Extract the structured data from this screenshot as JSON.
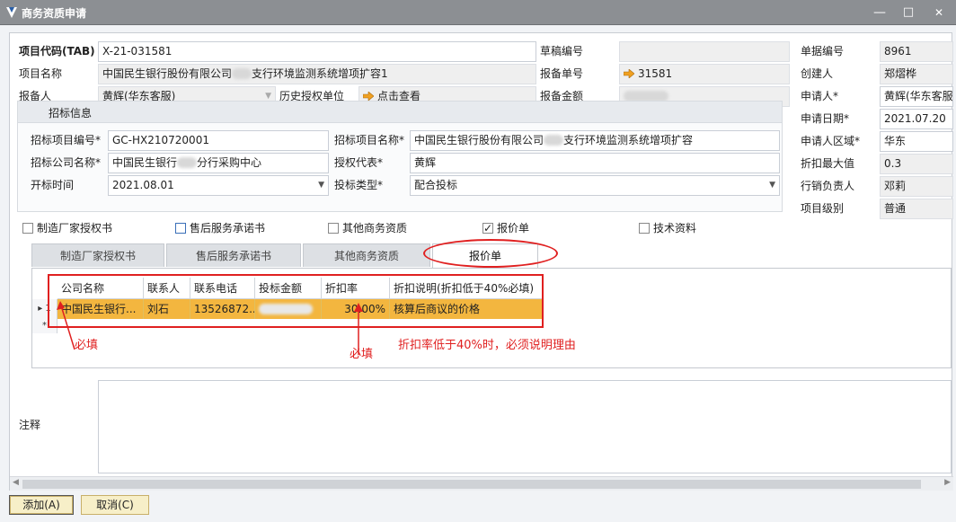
{
  "window": {
    "title": "商务资质申请",
    "minimize": "—",
    "maximize": "□",
    "close": "✕"
  },
  "top_left": {
    "project_code_label": "项目代码(TAB)",
    "project_code": "X-21-031581",
    "project_name_label": "项目名称",
    "project_name_a": "中国民生银行股份有限公司",
    "project_name_b": "支行环境监测系统增项扩容1",
    "reporter_label": "报备人",
    "reporter": "黄辉(华东客服)",
    "hist_auth_label": "历史授权单位",
    "hist_auth_link": "点击查看"
  },
  "top_mid": {
    "draft_no_label": "草稿编号",
    "draft_no": "",
    "report_no_label": "报备单号",
    "report_no": "31581",
    "report_amount_label": "报备金额",
    "report_amount": ""
  },
  "top_right": {
    "doc_no_label": "单据编号",
    "doc_no": "8961",
    "creator_label": "创建人",
    "creator": "郑熠桦",
    "applicant_label": "申请人*",
    "applicant": "黄辉(华东客服",
    "apply_date_label": "申请日期*",
    "apply_date": "2021.07.20",
    "region_label": "申请人区域*",
    "region": "华东",
    "max_discount_label": "折扣最大值",
    "max_discount": "0.3",
    "sales_lead_label": "行销负责人",
    "sales_lead": "邓莉",
    "project_level_label": "项目级别",
    "project_level": "普通"
  },
  "bid": {
    "group_title": "招标信息",
    "bid_no_label": "招标项目编号*",
    "bid_no": "GC-HX210720001",
    "bid_name_label": "招标项目名称*",
    "bid_name_a": "中国民生银行股份有限公司",
    "bid_name_b": "支行环境监测系统增项扩容",
    "bid_company_label": "招标公司名称*",
    "bid_company_a": "中国民生银行",
    "bid_company_b": "分行采购中心",
    "auth_rep_label": "授权代表*",
    "auth_rep": "黄辉",
    "open_time_label": "开标时间",
    "open_time": "2021.08.01",
    "bid_type_label": "投标类型*",
    "bid_type": "配合投标"
  },
  "checks": [
    {
      "label": "制造厂家授权书",
      "checked": false
    },
    {
      "label": "售后服务承诺书",
      "checked": false
    },
    {
      "label": "其他商务资质",
      "checked": false
    },
    {
      "label": "报价单",
      "checked": true
    },
    {
      "label": "技术资料",
      "checked": false
    }
  ],
  "tabs": [
    "制造厂家授权书",
    "售后服务承诺书",
    "其他商务资质",
    "报价单"
  ],
  "grid": {
    "headers": [
      "公司名称",
      "联系人",
      "联系电话",
      "投标金额",
      "折扣率",
      "折扣说明(折扣低于40%必填)"
    ],
    "row": {
      "marker": "▸",
      "index": "1",
      "company": "中国民生银行...",
      "contact": "刘石",
      "phone": "13526872...",
      "amount": "",
      "discount": "30.00%",
      "note": "核算后商议的价格"
    },
    "new_row_marker": "*"
  },
  "annotations": {
    "required_1": "必填",
    "required_2": "必填",
    "discount_rule": "折扣率低于40%时，必须说明理由"
  },
  "remark_label": "注释",
  "buttons": {
    "add": "添加(A)",
    "cancel": "取消(C)"
  },
  "colors": {
    "selection": "#f3b63f",
    "annotation": "#e02020",
    "titlebar": "#8c8f93"
  }
}
